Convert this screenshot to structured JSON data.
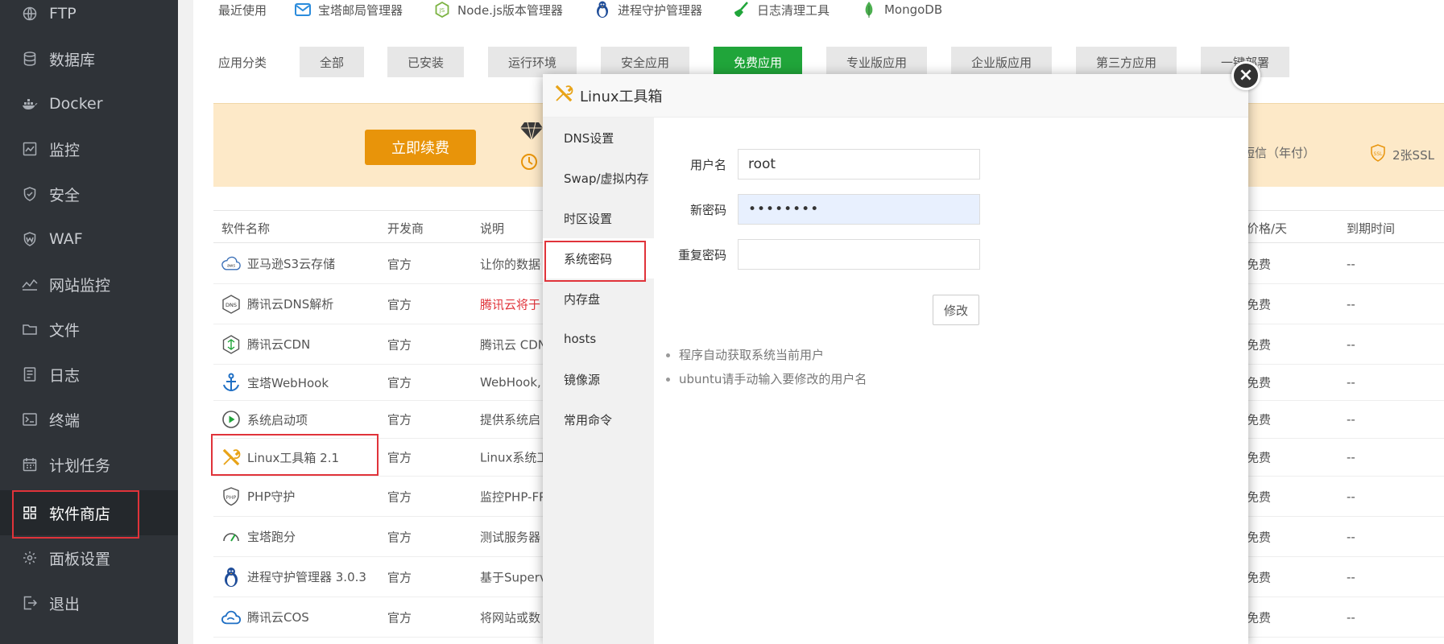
{
  "sidebar": {
    "items": [
      {
        "label": "FTP",
        "icon": "globe-icon"
      },
      {
        "label": "数据库",
        "icon": "database-icon"
      },
      {
        "label": "Docker",
        "icon": "docker-icon"
      },
      {
        "label": "监控",
        "icon": "monitor-icon"
      },
      {
        "label": "安全",
        "icon": "shield-icon"
      },
      {
        "label": "WAF",
        "icon": "waf-icon"
      },
      {
        "label": "网站监控",
        "icon": "chart-line-icon"
      },
      {
        "label": "文件",
        "icon": "folder-icon"
      },
      {
        "label": "日志",
        "icon": "log-icon"
      },
      {
        "label": "终端",
        "icon": "terminal-icon"
      },
      {
        "label": "计划任务",
        "icon": "calendar-icon"
      },
      {
        "label": "软件商店",
        "icon": "grid-icon"
      },
      {
        "label": "面板设置",
        "icon": "gear-icon"
      },
      {
        "label": "退出",
        "icon": "logout-icon"
      }
    ]
  },
  "recent": {
    "label": "最近使用",
    "items": [
      "宝塔邮局管理器",
      "Node.js版本管理器",
      "进程守护管理器",
      "日志清理工具",
      "MongoDB"
    ]
  },
  "categories": {
    "label": "应用分类",
    "items": [
      "全部",
      "已安装",
      "运行环境",
      "安全应用",
      "免费应用",
      "专业版应用",
      "企业版应用",
      "第三方应用",
      "一键部署"
    ],
    "active": "免费应用"
  },
  "banner": {
    "renew_label": "立即续费",
    "item1": "短信（年付）",
    "item2": "2张SSL"
  },
  "table": {
    "headers": {
      "name": "软件名称",
      "developer": "开发商",
      "desc": "说明",
      "price": "价格/天",
      "expire": "到期时间"
    },
    "rows": [
      {
        "name": "亚马逊S3云存储",
        "dev": "官方",
        "desc": "让你的数据",
        "price": "免费",
        "expire": "--"
      },
      {
        "name": "腾讯云DNS解析",
        "dev": "官方",
        "desc": "腾讯云将于",
        "price": "免费",
        "expire": "--"
      },
      {
        "name": "腾讯云CDN",
        "dev": "官方",
        "desc": "腾讯云 CDN",
        "price": "免费",
        "expire": "--"
      },
      {
        "name": "宝塔WebHook",
        "dev": "官方",
        "desc": "WebHook,",
        "price": "免费",
        "expire": "--"
      },
      {
        "name": "系统启动项",
        "dev": "官方",
        "desc": "提供系统启",
        "price": "免费",
        "expire": "--"
      },
      {
        "name": "Linux工具箱 2.1",
        "dev": "官方",
        "desc": "Linux系统工",
        "price": "免费",
        "expire": "--"
      },
      {
        "name": "PHP守护",
        "dev": "官方",
        "desc": "监控PHP-FP",
        "price": "免费",
        "expire": "--"
      },
      {
        "name": "宝塔跑分",
        "dev": "官方",
        "desc": "测试服务器",
        "price": "免费",
        "expire": "--"
      },
      {
        "name": "进程守护管理器 3.0.3",
        "dev": "官方",
        "desc": "基于Superv",
        "price": "免费",
        "expire": "--"
      },
      {
        "name": "腾讯云COS",
        "dev": "官方",
        "desc": "将网站或数",
        "price": "免费",
        "expire": "--"
      }
    ]
  },
  "modal": {
    "title": "Linux工具箱",
    "nav": [
      "DNS设置",
      "Swap/虚拟内存",
      "时区设置",
      "系统密码",
      "内存盘",
      "hosts",
      "镜像源",
      "常用命令"
    ],
    "active_nav": "系统密码",
    "form": {
      "username_label": "用户名",
      "username_value": "root",
      "new_password_label": "新密码",
      "new_password_value": "••••••••",
      "repeat_password_label": "重复密码",
      "repeat_password_value": ""
    },
    "modify_label": "修改",
    "tips": [
      "程序自动获取系统当前用户",
      "ubuntu请手动输入要修改的用户名"
    ]
  }
}
